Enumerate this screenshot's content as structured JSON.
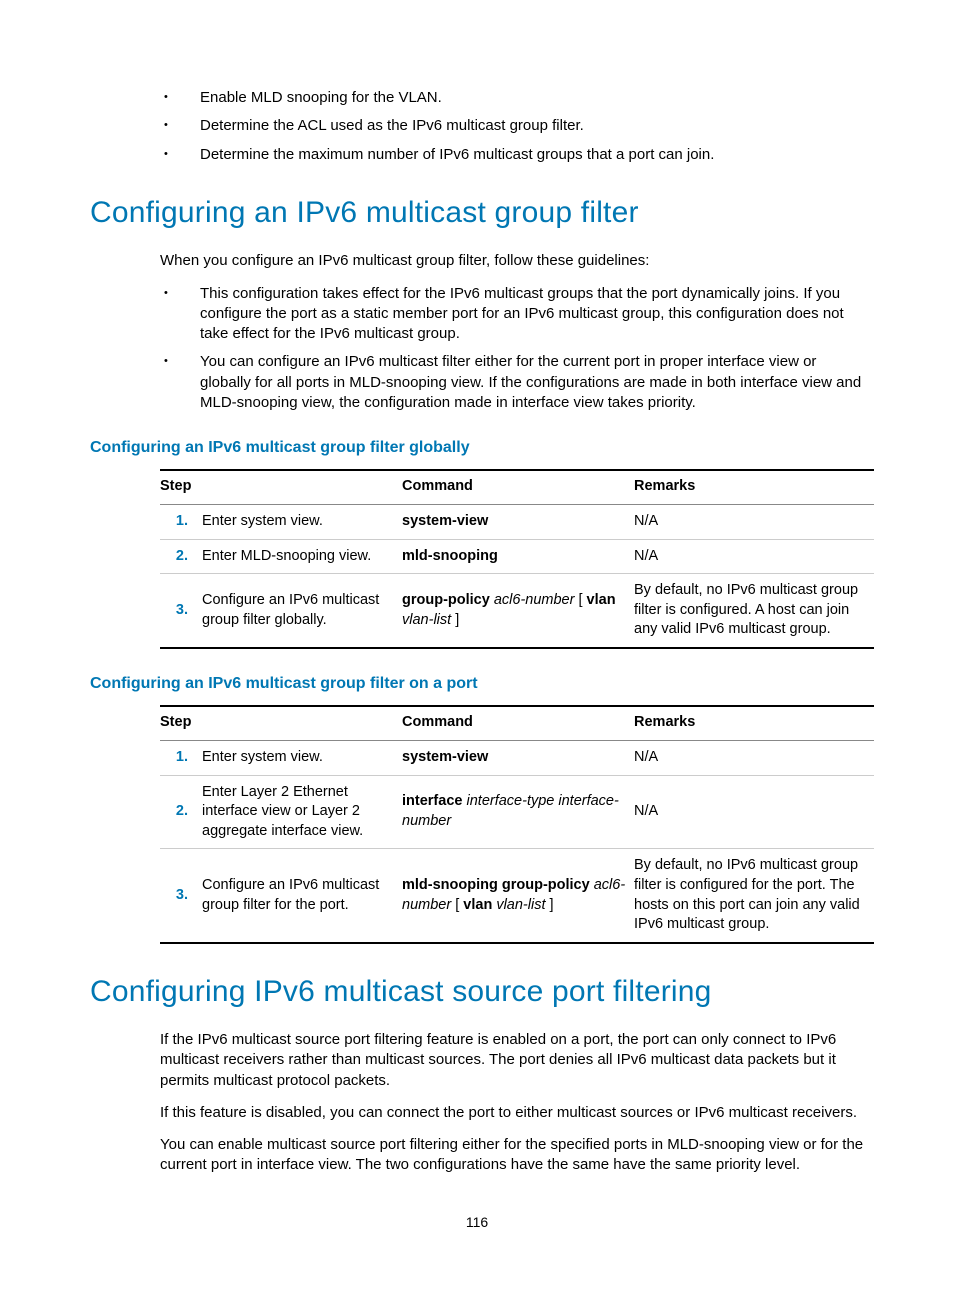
{
  "intro_bullets": [
    "Enable MLD snooping for the VLAN.",
    "Determine the ACL used as the IPv6 multicast group filter.",
    "Determine the maximum number of IPv6 multicast groups that a port can join."
  ],
  "section1": {
    "title": "Configuring an IPv6 multicast group filter",
    "intro": "When you configure an IPv6 multicast group filter, follow these guidelines:",
    "bullets": [
      "This configuration takes effect for the IPv6 multicast groups that the port dynamically joins. If you configure the port as a static member port for an IPv6 multicast group, this configuration does not take effect for the IPv6 multicast group.",
      "You can configure an IPv6 multicast filter either for the current port in proper interface view or globally for all ports in MLD-snooping view. If the configurations are made in both interface view and MLD-snooping view, the configuration made in interface view takes priority."
    ],
    "sub1": {
      "title": "Configuring an IPv6 multicast group filter globally",
      "headers": {
        "step": "Step",
        "command": "Command",
        "remarks": "Remarks"
      },
      "rows": [
        {
          "n": "1.",
          "desc": "Enter system view.",
          "cmd": {
            "b1": "system-view"
          },
          "remarks": "N/A"
        },
        {
          "n": "2.",
          "desc": "Enter MLD-snooping view.",
          "cmd": {
            "b1": "mld-snooping"
          },
          "remarks": "N/A"
        },
        {
          "n": "3.",
          "desc": "Configure an IPv6 multicast group filter globally.",
          "cmd": {
            "b1": "group-policy",
            "i1": "acl6-number",
            "t1": " [ ",
            "b2": "vlan",
            "i2": "vlan-list",
            "t2": " ]"
          },
          "remarks": "By default, no IPv6 multicast group filter is configured. A host can join any valid IPv6 multicast group."
        }
      ]
    },
    "sub2": {
      "title": "Configuring an IPv6 multicast group filter on a port",
      "headers": {
        "step": "Step",
        "command": "Command",
        "remarks": "Remarks"
      },
      "rows": [
        {
          "n": "1.",
          "desc": "Enter system view.",
          "cmd": {
            "b1": "system-view"
          },
          "remarks": "N/A"
        },
        {
          "n": "2.",
          "desc": "Enter Layer 2 Ethernet interface view or Layer 2 aggregate interface view.",
          "cmd": {
            "b1": "interface",
            "i1": "interface-type interface-number"
          },
          "remarks": "N/A"
        },
        {
          "n": "3.",
          "desc": "Configure an IPv6 multicast group filter for the port.",
          "cmd": {
            "b1": "mld-snooping group-policy",
            "i1": "acl6-number",
            "t1": " [ ",
            "b2": "vlan",
            "i2": "vlan-list",
            "t2": " ]"
          },
          "remarks": "By default, no IPv6 multicast group filter is configured for the port. The hosts on this port can join any valid IPv6 multicast group."
        }
      ]
    }
  },
  "section2": {
    "title": "Configuring IPv6 multicast source port filtering",
    "paras": [
      "If the IPv6 multicast source port filtering feature is enabled on a port, the port can only connect to IPv6 multicast receivers rather than multicast sources. The port denies all IPv6 multicast data packets but it permits multicast protocol packets.",
      "If this feature is disabled, you can connect the port to either multicast sources or IPv6 multicast receivers.",
      "You can enable multicast source port filtering either for the specified ports in MLD-snooping view or for the current port in interface view. The two configurations have the same have the same priority level."
    ]
  },
  "page_number": "116"
}
